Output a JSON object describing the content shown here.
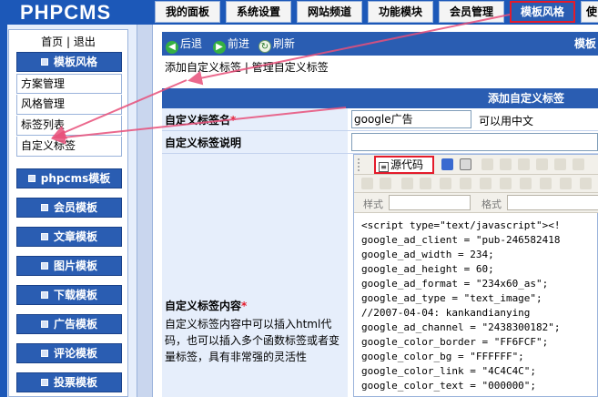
{
  "app": {
    "logo": "PHPCMS"
  },
  "tabs": [
    {
      "label": "我的面板"
    },
    {
      "label": "系统设置"
    },
    {
      "label": "网站频道"
    },
    {
      "label": "功能模块"
    },
    {
      "label": "会员管理"
    },
    {
      "label": "模板风格"
    },
    {
      "label": "使"
    }
  ],
  "sidebar": {
    "home": "首页",
    "sep": "|",
    "exit": "退出",
    "section": "模板风格",
    "sub_items": [
      "方案管理",
      "风格管理",
      "标签列表",
      "自定义标签"
    ],
    "groups": [
      "phpcms模板",
      "会员模板",
      "文章模板",
      "图片模板",
      "下载模板",
      "广告模板",
      "评论模板",
      "投票模板"
    ]
  },
  "nav": {
    "back": "后退",
    "forward": "前进",
    "refresh": "刷新",
    "right": "模板"
  },
  "links": {
    "add": "添加自定义标签",
    "sep": "|",
    "manage": "管理自定义标签"
  },
  "form": {
    "title": "添加自定义标签",
    "name_label": "自定义标签名",
    "name_req": "*",
    "name_value": "google广告",
    "name_hint": "可以用中文",
    "desc_label": "自定义标签说明",
    "content_label": "自定义标签内容",
    "content_req": "*",
    "content_help": "自定义标签内容中可以插入html代码，也可以插入多个函数标签或者变量标签，具有非常强的灵活性"
  },
  "editor": {
    "source_btn": "源代码",
    "style_label": "样式",
    "format_label": "格式",
    "code_lines": [
      "<script type=\"text/javascript\"><!",
      "google_ad_client = \"pub-246582418",
      "google_ad_width = 234;",
      "google_ad_height = 60;",
      "google_ad_format = \"234x60_as\";",
      "google_ad_type = \"text_image\";",
      "//2007-04-04: kankandianying",
      "google_ad_channel = \"2438300182\";",
      "google_color_border = \"FF6FCF\";",
      "google_color_bg = \"FFFFFF\";",
      "google_color_link = \"4C4C4C\";",
      "google_color_text = \"000000\";"
    ]
  }
}
